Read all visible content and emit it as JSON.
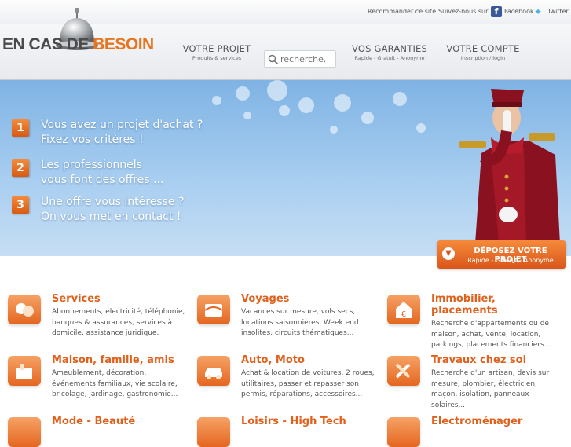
{
  "topbar": {
    "recommend": "Recommander ce site",
    "follow": "Suivez-nous sur",
    "facebook": "Facebook",
    "twitter": "Twitter"
  },
  "logo": {
    "part1": "EN CAS DE ",
    "part2": "BESOIN"
  },
  "nav": [
    {
      "main": "VOTRE PROJET",
      "sub": "Produits & services"
    },
    {
      "main": "VOS GARANTIES",
      "sub": "Rapide - Gratuit - Anonyme"
    },
    {
      "main": "VOTRE COMPTE",
      "sub": "Inscription / login"
    }
  ],
  "search": {
    "placeholder": "recherche."
  },
  "steps": [
    {
      "num": "1",
      "line1": "Vous avez un projet d'achat ?",
      "line2": "Fixez vos critères !"
    },
    {
      "num": "2",
      "line1": "Les professionnels",
      "line2": "vous font des offres ..."
    },
    {
      "num": "3",
      "line1": "Une offre vous intéresse ?",
      "line2": "On vous met en contact !"
    }
  ],
  "cta": {
    "title": "DÉPOSEZ VOTRE PROJET",
    "sub": "Rapide - Gratuit - Anonyme"
  },
  "categories": [
    {
      "title": "Services",
      "text": "Abonnements, électricité, téléphonie, banques & assurances, services à domicile, assistance juridique.",
      "icon": "services-icon"
    },
    {
      "title": "Voyages",
      "text": "Vacances sur mesure, vols secs, locations saisonnières, Week end insolites, circuits thématiques...",
      "icon": "voyages-icon"
    },
    {
      "title": "Immobilier, placements",
      "text": "Recherche d'appartements ou de maison, achat, vente, location, parkings, placements financiers...",
      "icon": "immobilier-icon"
    },
    {
      "title": "Maison, famille, amis",
      "text": "Ameublement, décoration, événements familiaux, vie scolaire, bricolage, jardinage, gastronomie...",
      "icon": "maison-icon"
    },
    {
      "title": "Auto, Moto",
      "text": "Achat & location de voitures, 2 roues, utilitaires, passer et repasser son permis, réparations, accessoires...",
      "icon": "auto-icon"
    },
    {
      "title": "Travaux chez soi",
      "text": "Recherche d'un artisan, devis sur mesure, plombier, électricien, maçon, isolation, panneaux solaires...",
      "icon": "travaux-icon"
    },
    {
      "title": "Mode - Beauté",
      "text": "",
      "icon": "mode-icon"
    },
    {
      "title": "Loisirs - High Tech",
      "text": "",
      "icon": "loisirs-icon"
    },
    {
      "title": "Electroménager",
      "text": "",
      "icon": "electromenager-icon"
    }
  ]
}
